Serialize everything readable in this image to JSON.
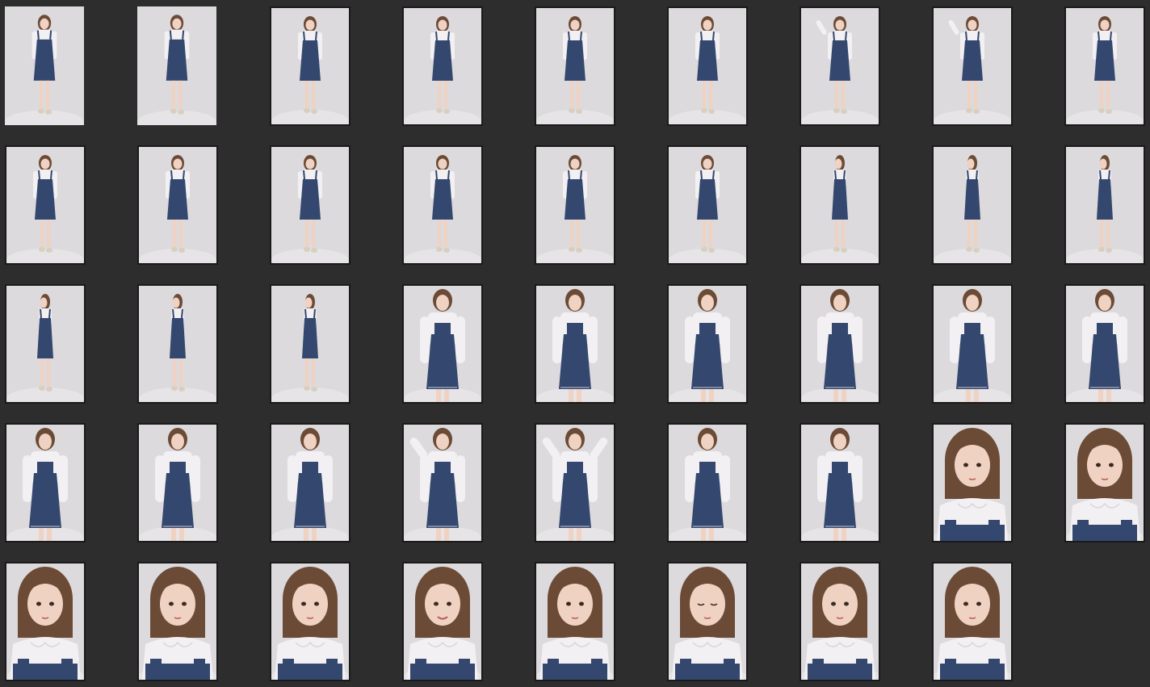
{
  "gallery": {
    "thumbnails": [
      {
        "shot": "full",
        "pose": "stand",
        "frame": false
      },
      {
        "shot": "full",
        "pose": "stand",
        "frame": false
      },
      {
        "shot": "full",
        "pose": "stand",
        "frame": true
      },
      {
        "shot": "full",
        "pose": "stand",
        "frame": true
      },
      {
        "shot": "full",
        "pose": "hand-chest",
        "frame": true
      },
      {
        "shot": "full",
        "pose": "hand-chest",
        "frame": true
      },
      {
        "shot": "full",
        "pose": "hand-head",
        "frame": true
      },
      {
        "shot": "full",
        "pose": "hand-head",
        "frame": true
      },
      {
        "shot": "full",
        "pose": "stand",
        "frame": true
      },
      {
        "shot": "full",
        "pose": "turn",
        "frame": true
      },
      {
        "shot": "full",
        "pose": "stand",
        "frame": true
      },
      {
        "shot": "full",
        "pose": "arms-crossed",
        "frame": true
      },
      {
        "shot": "full",
        "pose": "hand-chest",
        "frame": true
      },
      {
        "shot": "full",
        "pose": "hand-chest",
        "frame": true
      },
      {
        "shot": "full",
        "pose": "hand-chest",
        "frame": true
      },
      {
        "shot": "full",
        "pose": "side",
        "frame": true
      },
      {
        "shot": "full",
        "pose": "side",
        "frame": true
      },
      {
        "shot": "full",
        "pose": "side",
        "frame": true
      },
      {
        "shot": "full",
        "pose": "side",
        "frame": true
      },
      {
        "shot": "full",
        "pose": "side",
        "frame": true
      },
      {
        "shot": "full",
        "pose": "side",
        "frame": true
      },
      {
        "shot": "mid",
        "pose": "stand",
        "frame": true
      },
      {
        "shot": "mid",
        "pose": "stand",
        "frame": true
      },
      {
        "shot": "mid",
        "pose": "stand",
        "frame": true
      },
      {
        "shot": "mid",
        "pose": "hand-chest",
        "frame": true
      },
      {
        "shot": "mid",
        "pose": "stand",
        "frame": true
      },
      {
        "shot": "mid",
        "pose": "hand-hip",
        "frame": true
      },
      {
        "shot": "mid",
        "pose": "hand-hip",
        "frame": true
      },
      {
        "shot": "mid",
        "pose": "hand-hip",
        "frame": true
      },
      {
        "shot": "mid",
        "pose": "hand-chest",
        "frame": true
      },
      {
        "shot": "mid",
        "pose": "peace",
        "frame": true
      },
      {
        "shot": "mid",
        "pose": "both-hands-up",
        "frame": true
      },
      {
        "shot": "mid",
        "pose": "stand",
        "frame": true
      },
      {
        "shot": "mid",
        "pose": "stand",
        "frame": true
      },
      {
        "shot": "close",
        "pose": "portrait",
        "frame": true
      },
      {
        "shot": "close",
        "pose": "portrait",
        "frame": true
      },
      {
        "shot": "close",
        "pose": "portrait",
        "frame": true
      },
      {
        "shot": "close",
        "pose": "portrait",
        "frame": true
      },
      {
        "shot": "close",
        "pose": "portrait",
        "frame": true
      },
      {
        "shot": "close",
        "pose": "smile",
        "frame": true
      },
      {
        "shot": "close",
        "pose": "portrait",
        "frame": true
      },
      {
        "shot": "close",
        "pose": "eyes-closed",
        "frame": true
      },
      {
        "shot": "close",
        "pose": "portrait",
        "frame": true
      },
      {
        "shot": "close",
        "pose": "portrait",
        "frame": true
      }
    ]
  },
  "colors": {
    "background": "#2d2d2d",
    "frame": "#1a1a1a",
    "backdrop": "#dcdadc",
    "denim": "#34476e",
    "blouse": "#f2f0f2",
    "skin": "#f0d2c2",
    "hair": "#6b4a36",
    "shoe": "#d8cfbf"
  }
}
